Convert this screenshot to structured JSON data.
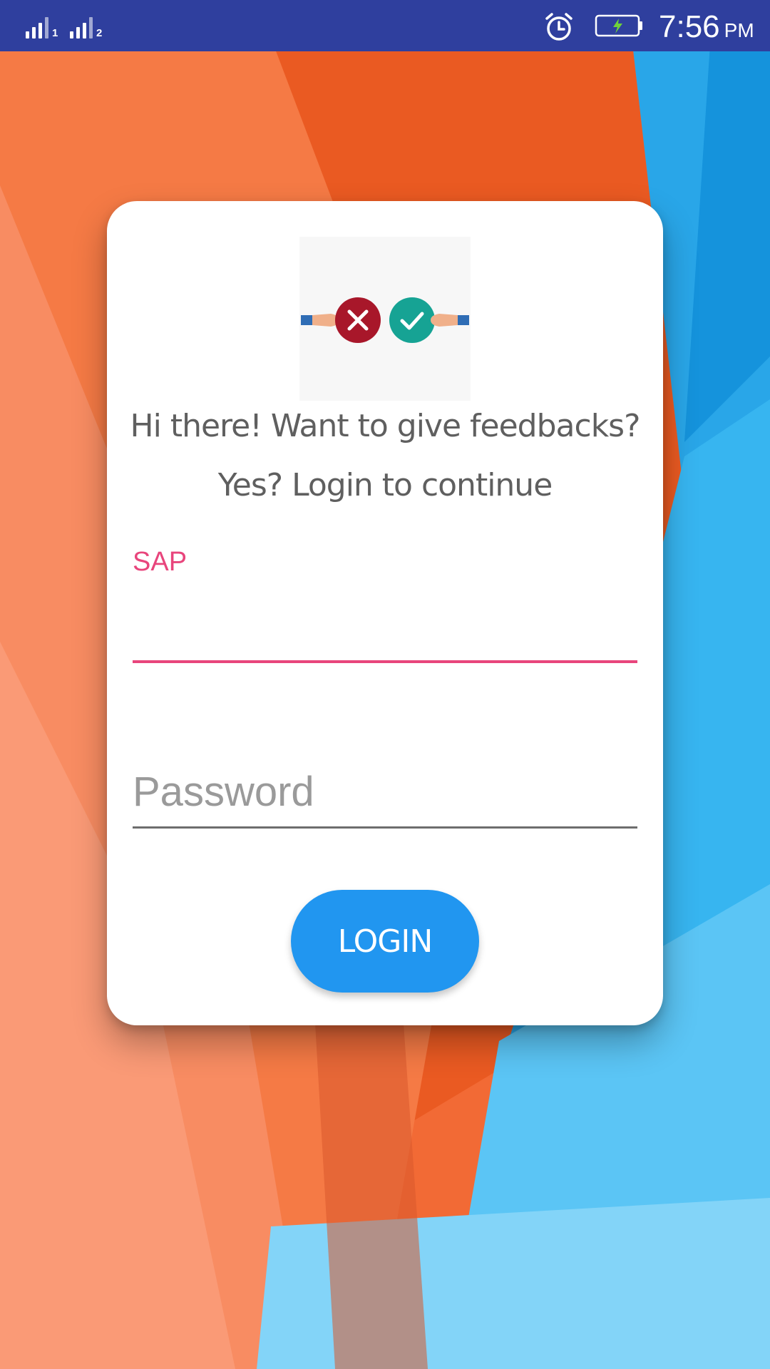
{
  "status_bar": {
    "sim1_label": "1",
    "sim2_label": "2",
    "alarm_icon": "alarm-clock-icon",
    "battery_icon": "battery-charging-icon",
    "time": "7:56",
    "ampm": "PM"
  },
  "login_card": {
    "logo_icon": "feedback-yes-no-logo",
    "headline_line1": "Hi there! Want to give feedbacks?",
    "headline_line2": "Yes? Login to continue",
    "sap_label": "SAP",
    "sap_value": "",
    "password_placeholder": "Password",
    "login_button": "LOGIN"
  },
  "colors": {
    "status_bar": "#2f3f9e",
    "accent_pink": "#e8457c",
    "button_blue": "#2196f0",
    "logo_red": "#a8172a",
    "logo_green": "#16a394"
  }
}
